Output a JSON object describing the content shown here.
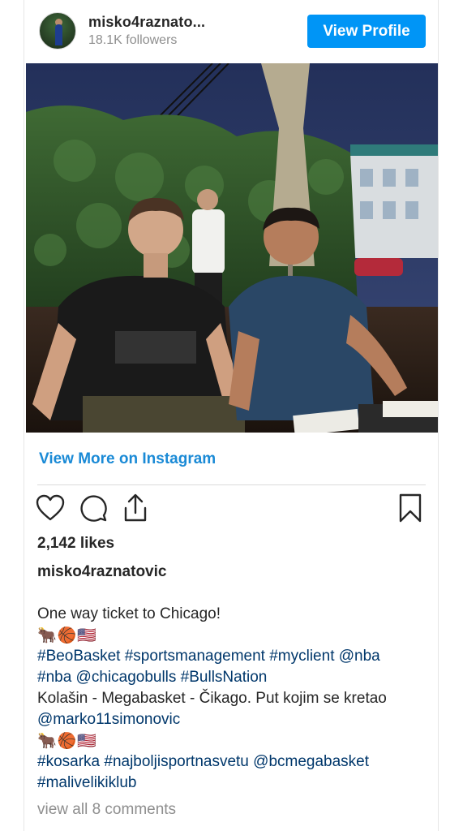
{
  "header": {
    "username": "misko4raznato...",
    "followers": "18.1K followers",
    "view_profile_label": "View Profile"
  },
  "post": {
    "photo_alt": "",
    "view_more_label": "View More on Instagram",
    "likes": "2,142 likes",
    "caption_username": "misko4raznatovic",
    "caption_lines": [
      {
        "text": "One way ticket to Chicago!",
        "type": "text"
      },
      {
        "text": "🐂🏀🇺🇸",
        "type": "emoji"
      },
      {
        "text": "#BeoBasket #sportsmanagement #myclient @nba",
        "type": "tag"
      },
      {
        "text": "#nba @chicagobulls #BullsNation",
        "type": "tag"
      },
      {
        "text": "Kolašin - Megabasket - Čikago. Put kojim se kretao",
        "type": "text"
      },
      {
        "text": "@marko11simonovic",
        "type": "tag"
      },
      {
        "text": "🐂🏀🇺🇸",
        "type": "emoji"
      },
      {
        "text": "#kosarka #najboljisportnasvetu @bcmegabasket",
        "type": "tag"
      },
      {
        "text": "#malivelikiklub",
        "type": "tag"
      }
    ],
    "comments_label": "view all 8 comments"
  },
  "icons": [
    "heart-icon",
    "comment-icon",
    "share-icon",
    "bookmark-icon"
  ],
  "colors": {
    "primary_button": "#0095f6",
    "link": "#1a8ad6",
    "hashtag": "#00376b",
    "muted": "#8e8e8e"
  }
}
